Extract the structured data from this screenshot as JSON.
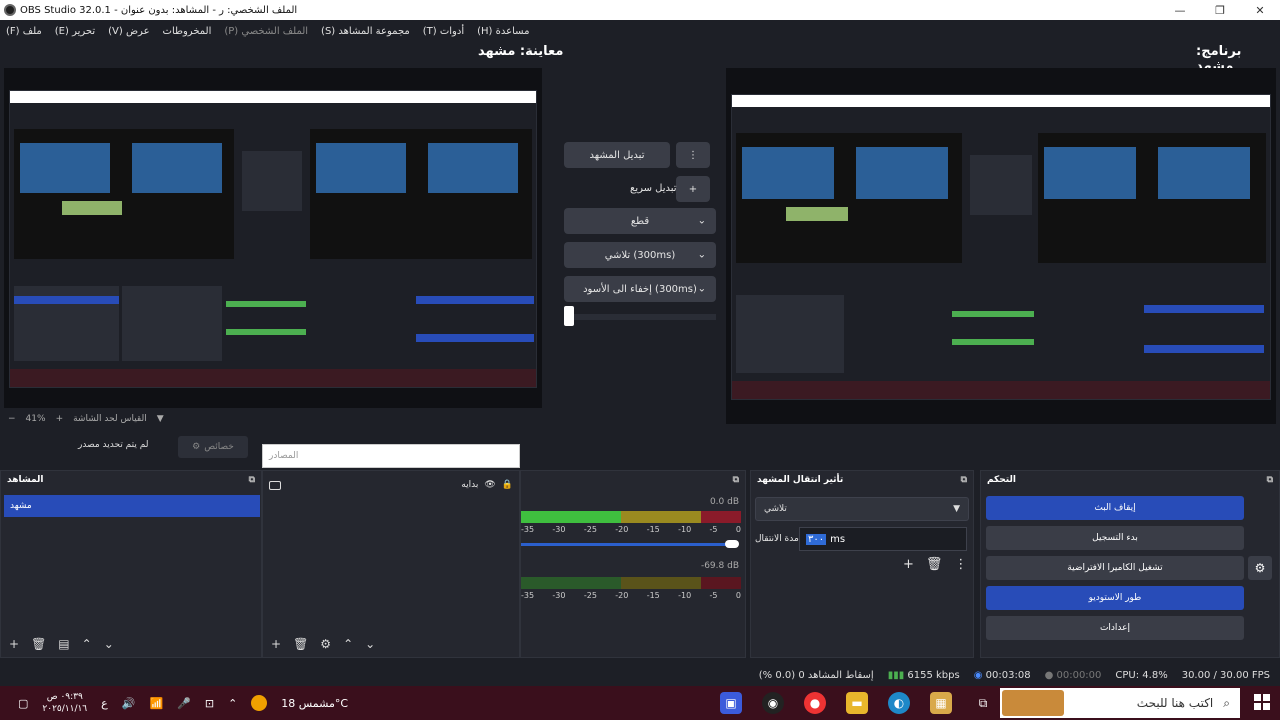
{
  "window": {
    "title": "OBS Studio 32.0.1 - الملف الشخصي: ر - المشاهد: بدون عنوان",
    "minimize": "—",
    "maximize": "❐",
    "close": "✕"
  },
  "menu": [
    {
      "label": "(F) ملف",
      "dim": false
    },
    {
      "label": "(E) تحرير",
      "dim": false
    },
    {
      "label": "(V) عرض",
      "dim": false
    },
    {
      "label": "المخروطات",
      "dim": false
    },
    {
      "label": "(P) الملف الشخصي",
      "dim": true
    },
    {
      "label": "(S) مجموعة المشاهد",
      "dim": false
    },
    {
      "label": "(T) أدوات",
      "dim": false
    },
    {
      "label": "(H) مساعدة",
      "dim": false
    }
  ],
  "preview": {
    "label": "معاينة: مشهد"
  },
  "program": {
    "label": "برنامج: مشهد"
  },
  "transitions_col": {
    "menu_icon": "⋮",
    "switch_scene": "تبديل المشهد",
    "quick_transition_label": "تبديل سريع",
    "add_icon": "+",
    "cut": "قطع",
    "fade": "تلاشي (300ms)",
    "fade_to_black": "إخفاء الى الأسود (300ms)"
  },
  "zoom": {
    "minus": "−",
    "value": "41%",
    "plus": "+",
    "fit": "القياس لحد الشاشة",
    "caret": "▼"
  },
  "source_status": "لم يتم تحديد مصدر",
  "properties_button": "خصائص",
  "scenes_dock": {
    "title": "المشاهد",
    "items": [
      "مشهد"
    ]
  },
  "sources_dock": {
    "search_placeholder": "المصادر",
    "items": [
      {
        "name": "بدايه"
      }
    ]
  },
  "mixer": {
    "track1": {
      "db": "0.0 dB",
      "level": 0.42
    },
    "track2": {
      "db": "-69.8 dB",
      "level": 0.0
    },
    "scale": [
      "-35",
      "-30",
      "-25",
      "-20",
      "-15",
      "-10",
      "-5",
      "0"
    ]
  },
  "transitions_dock": {
    "title": "تأثير انتقال المشهد",
    "selected": "تلاشي",
    "duration_label": "مدة الانتقال",
    "duration_value": "٣٠٠",
    "duration_unit": "ms"
  },
  "controls_dock": {
    "title": "التحكم",
    "buttons": [
      {
        "label": "إيقاف البث",
        "active": true
      },
      {
        "label": "بدء التسجيل",
        "active": false
      },
      {
        "label": "تشغيل الكاميرا الافتراضية",
        "active": false
      },
      {
        "label": "طور الاستوديو",
        "active": true
      },
      {
        "label": "إعدادات",
        "active": false
      }
    ]
  },
  "statusbar": {
    "dropped": "إسقاط المشاهد 0 (0.0 %)",
    "bitrate": "6155 kbps",
    "stream_time": "00:03:08",
    "rec_time": "00:00:00",
    "cpu": "CPU: 4.8%",
    "fps": "30.00 / 30.00 FPS"
  },
  "taskbar": {
    "time": "٠٩:٣٩ ص",
    "date": "٢٠٢٥/١١/١٦",
    "lang": "ع",
    "weather": "مشمس 18°C",
    "search_placeholder": "اكتب هنا للبحث"
  },
  "colors": {
    "accent": "#284cb8",
    "meter_green": "#3fbf3f",
    "meter_yellow": "#9a8a20",
    "meter_red": "#8a1b2a"
  }
}
